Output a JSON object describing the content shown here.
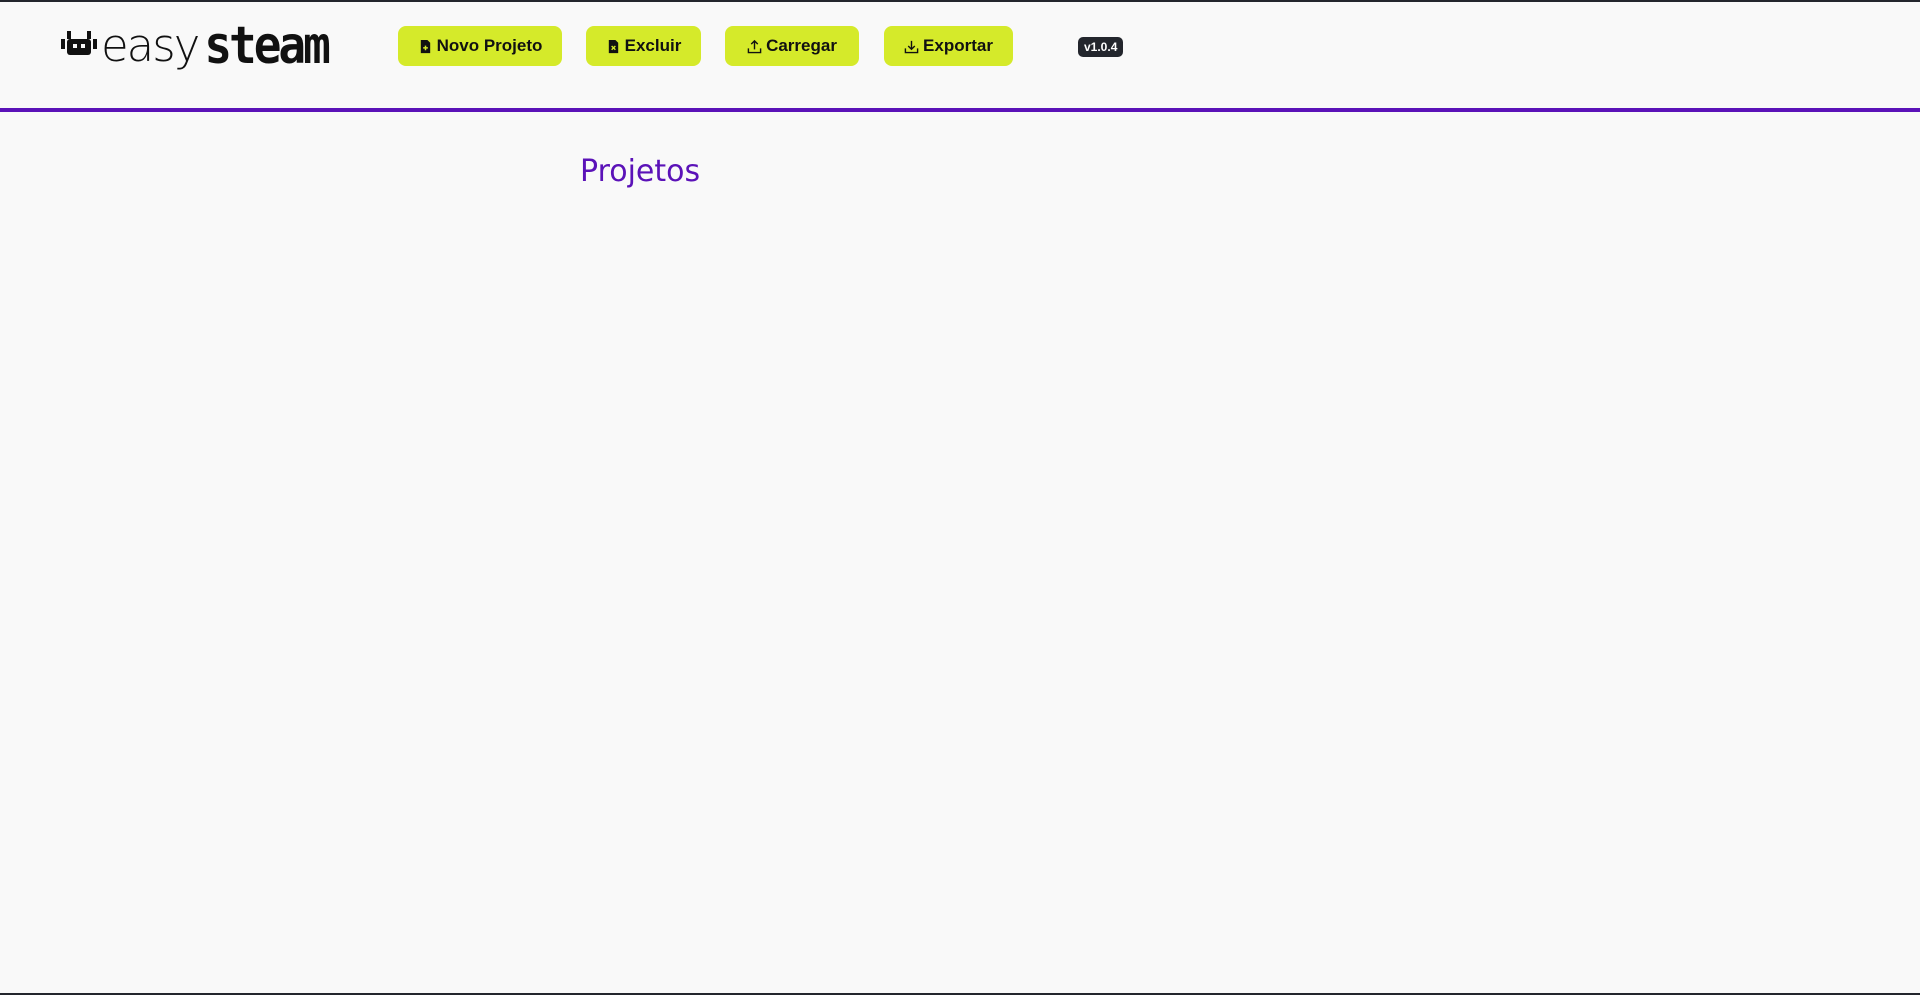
{
  "header": {
    "logo": {
      "text_light": "easy",
      "text_bold": "steam",
      "icon": "robot-head-icon"
    },
    "buttons": [
      {
        "label": "Novo Projeto",
        "icon": "file-plus-icon"
      },
      {
        "label": "Excluir",
        "icon": "file-x-icon"
      },
      {
        "label": "Carregar",
        "icon": "upload-icon"
      },
      {
        "label": "Exportar",
        "icon": "download-icon"
      }
    ],
    "version": "v1.0.4"
  },
  "main": {
    "title": "Projetos"
  },
  "colors": {
    "accent_purple": "#5b12b8",
    "button_lime": "#d5ea2a",
    "badge_dark": "#23262d",
    "background": "#f9f9f9"
  }
}
